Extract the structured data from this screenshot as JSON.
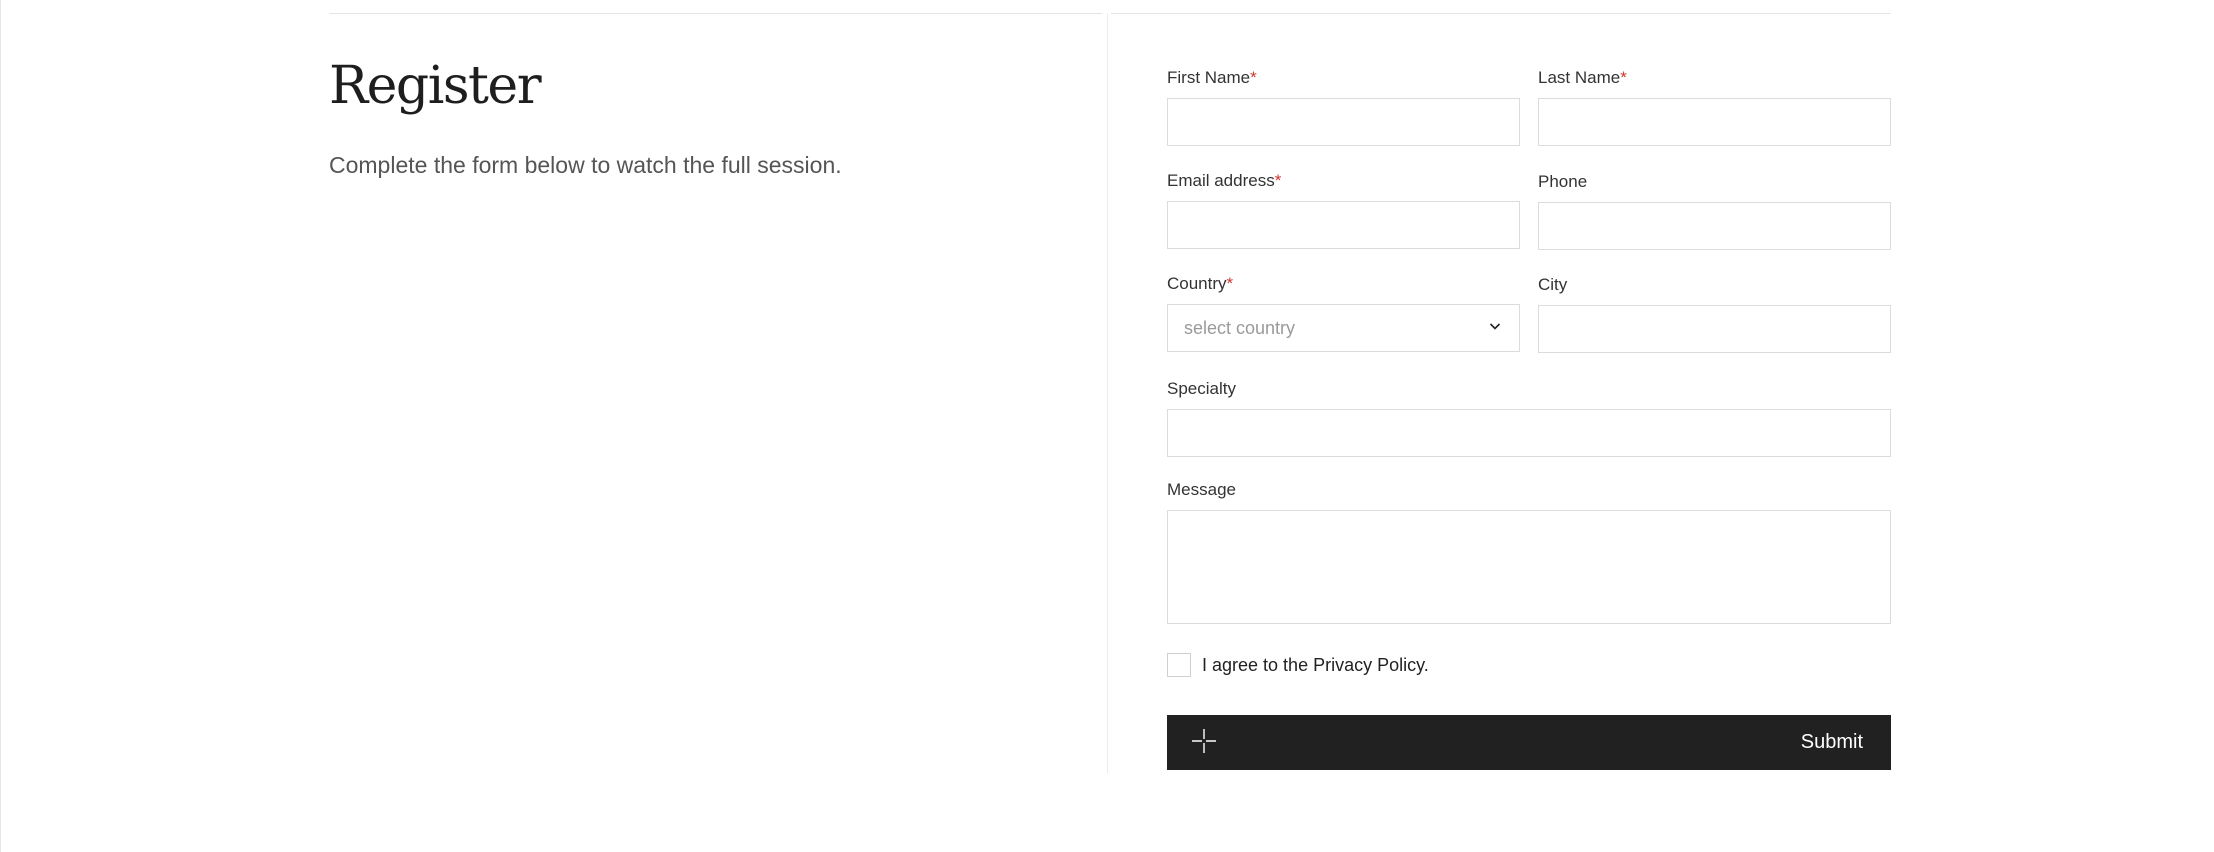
{
  "intro": {
    "title": "Register",
    "subtitle": "Complete the form below to watch the full session."
  },
  "form": {
    "required_marker": "*",
    "first_name": {
      "label": "First Name",
      "value": "",
      "required": true
    },
    "last_name": {
      "label": "Last Name",
      "value": "",
      "required": true
    },
    "email": {
      "label": "Email address",
      "value": "",
      "required": true
    },
    "phone": {
      "label": "Phone",
      "value": ""
    },
    "country": {
      "label": "Country",
      "placeholder": "select country",
      "required": true
    },
    "city": {
      "label": "City",
      "value": ""
    },
    "specialty": {
      "label": "Specialty",
      "value": ""
    },
    "message": {
      "label": "Message",
      "value": ""
    },
    "consent": {
      "label": "I agree to the Privacy Policy.",
      "checked": false
    },
    "submit": {
      "label": "Submit",
      "icon": "crosshair-icon"
    }
  },
  "colors": {
    "required": "#d0342c",
    "button_bg": "#222122",
    "border": "#dcdcdc"
  },
  "icons": {
    "country_select": "chevron-down-icon",
    "submit": "crosshair-icon"
  }
}
